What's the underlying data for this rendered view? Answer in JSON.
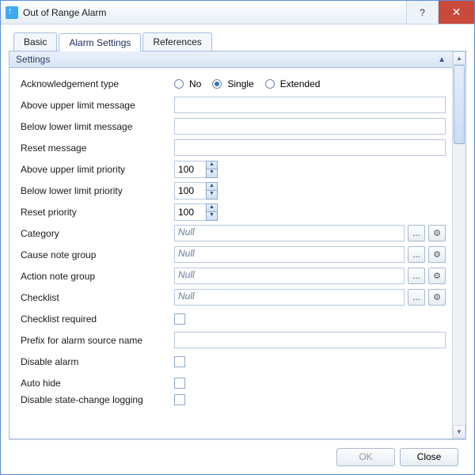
{
  "window": {
    "title": "Out of Range Alarm"
  },
  "tabs": {
    "basic": "Basic",
    "alarm": "Alarm Settings",
    "references": "References"
  },
  "section": {
    "title": "Settings"
  },
  "ack": {
    "label": "Acknowledgement type",
    "no": "No",
    "single": "Single",
    "extended": "Extended",
    "selected": "single"
  },
  "fields": {
    "above_msg": {
      "label": "Above upper limit message",
      "value": ""
    },
    "below_msg": {
      "label": "Below lower limit message",
      "value": ""
    },
    "reset_msg": {
      "label": "Reset message",
      "value": ""
    },
    "above_prio": {
      "label": "Above upper limit priority",
      "value": "100"
    },
    "below_prio": {
      "label": "Below lower limit priority",
      "value": "100"
    },
    "reset_prio": {
      "label": "Reset priority",
      "value": "100"
    },
    "category": {
      "label": "Category",
      "value": "Null"
    },
    "cause": {
      "label": "Cause note group",
      "value": "Null"
    },
    "action": {
      "label": "Action note group",
      "value": "Null"
    },
    "checklist": {
      "label": "Checklist",
      "value": "Null"
    },
    "checklist_req": {
      "label": "Checklist required"
    },
    "prefix": {
      "label": "Prefix for alarm source name",
      "value": ""
    },
    "disable": {
      "label": "Disable alarm"
    },
    "autohide": {
      "label": "Auto hide"
    },
    "disable_log": {
      "label": "Disable state-change logging"
    }
  },
  "browse": "...",
  "buttons": {
    "ok": "OK",
    "close": "Close"
  }
}
